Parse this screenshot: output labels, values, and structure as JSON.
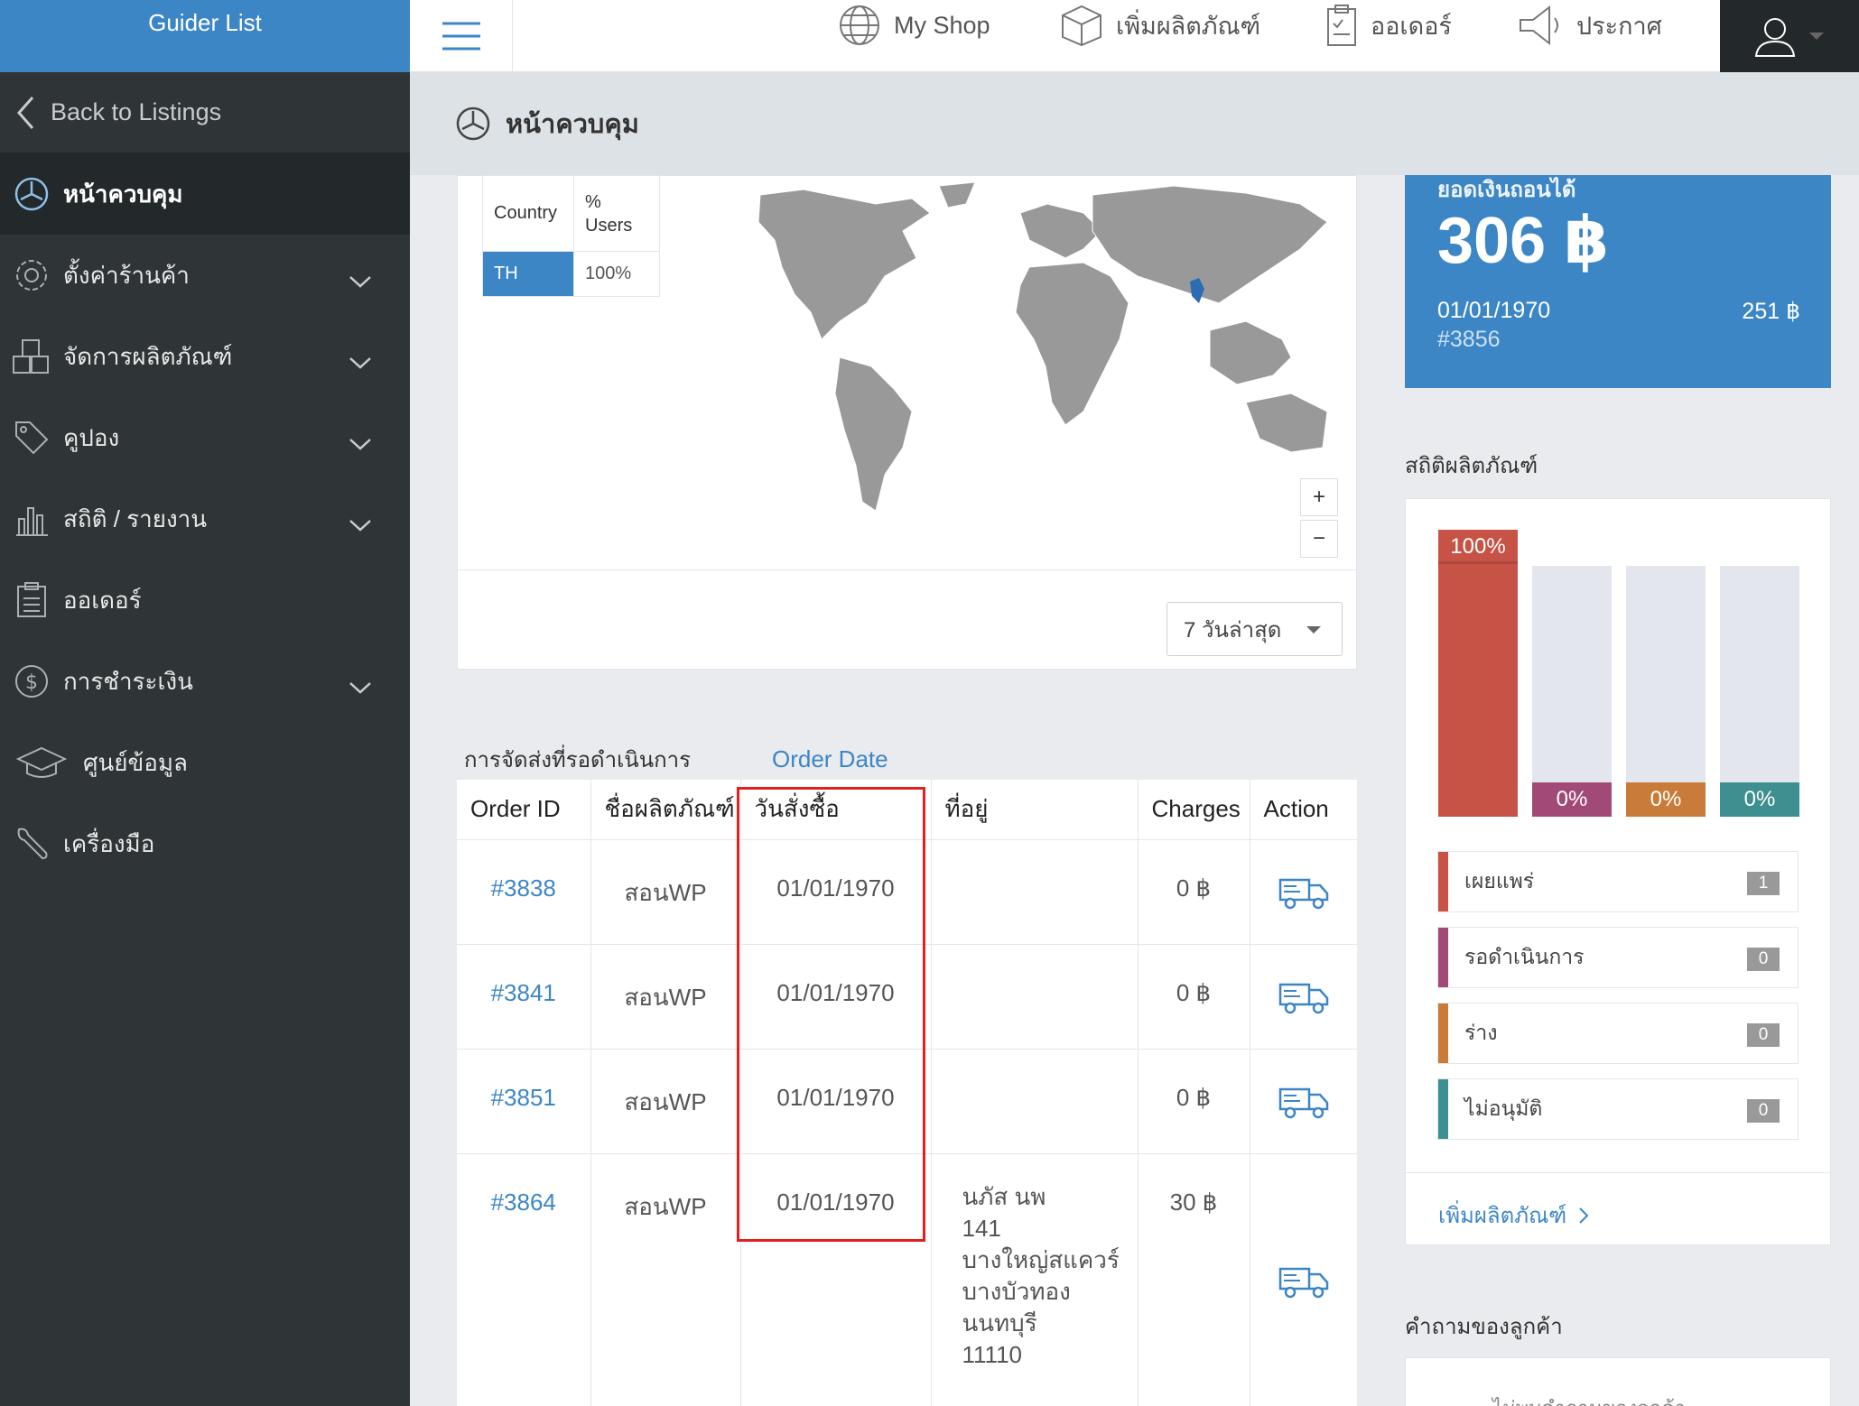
{
  "sidebar": {
    "brand": "Guider List",
    "back": "Back to Listings",
    "items": [
      {
        "label": "หน้าควบคุม",
        "icon": "dashboard-icon"
      },
      {
        "label": "ตั้งค่าร้านค้า",
        "icon": "gear-icon"
      },
      {
        "label": "จัดการผลิตภัณฑ์",
        "icon": "boxes-icon"
      },
      {
        "label": "คูปอง",
        "icon": "tag-icon"
      },
      {
        "label": "สถิติ / รายงาน",
        "icon": "bar-chart-icon"
      },
      {
        "label": "ออเดอร์",
        "icon": "clipboard-icon"
      },
      {
        "label": "การชำระเงิน",
        "icon": "dollar-icon"
      },
      {
        "label": "ศูนย์ข้อมูล",
        "icon": "graduation-cap-icon"
      },
      {
        "label": "เครื่องมือ",
        "icon": "wrench-icon"
      }
    ]
  },
  "topbar": {
    "myshop": "My Shop",
    "add_product": "เพิ่มผลิตภัณฑ์",
    "orders": "ออเดอร์",
    "announce": "ประกาศ"
  },
  "page": {
    "title": "หน้าควบคุม"
  },
  "map": {
    "col_country": "Country",
    "col_users": "% Users",
    "row_country": "TH",
    "row_users": "100%",
    "zoom_in": "+",
    "zoom_out": "−",
    "range_select": "7 วันล่าสุด"
  },
  "orders": {
    "section_title": "การจัดส่งที่รอดำเนินการ",
    "annotation": "Order Date",
    "headers": [
      "Order ID",
      "ชื่อผลิตภัณฑ์",
      "วันสั่งซื้อ",
      "ที่อยู่",
      "Charges",
      "Action"
    ],
    "rows": [
      {
        "id": "#3838",
        "product": "สอนWP",
        "date": "01/01/1970",
        "address": "",
        "charges": "0 ฿"
      },
      {
        "id": "#3841",
        "product": "สอนWP",
        "date": "01/01/1970",
        "address": "",
        "charges": "0 ฿"
      },
      {
        "id": "#3851",
        "product": "สอนWP",
        "date": "01/01/1970",
        "address": "",
        "charges": "0 ฿"
      },
      {
        "id": "#3864",
        "product": "สอนWP",
        "date": "01/01/1970",
        "address": [
          "นภัส นพ",
          "141",
          "บางใหญ่สแควร์",
          "บางบัวทอง",
          "นนทบุรี",
          "11110"
        ],
        "charges": "30 ฿"
      }
    ]
  },
  "balance": {
    "label": "ยอดเงินถอนได้",
    "amount": "306 ฿",
    "date": "01/01/1970",
    "last_amount": "251 ฿",
    "order_ref": "#3856"
  },
  "product_stats": {
    "title": "สถิติผลิตภัณฑ์",
    "bars": [
      {
        "label": "100%",
        "fraction": 1.0,
        "color": "#c65346"
      },
      {
        "label": "0%",
        "fraction": 0.0,
        "color": "#a24a77"
      },
      {
        "label": "0%",
        "fraction": 0.0,
        "color": "#c97b3a"
      },
      {
        "label": "0%",
        "fraction": 0.0,
        "color": "#3e8f8f"
      }
    ],
    "rows": [
      {
        "label": "เผยแพร่",
        "count": "1",
        "color": "#c65346"
      },
      {
        "label": "รอดำเนินการ",
        "count": "0",
        "color": "#a24a77"
      },
      {
        "label": "ร่าง",
        "count": "0",
        "color": "#c97b3a"
      },
      {
        "label": "ไม่อนุมัติ",
        "count": "0",
        "color": "#3e8f8f"
      }
    ],
    "add_link": "เพิ่มผลิตภัณฑ์"
  },
  "questions": {
    "title": "คำถามของลูกค้า",
    "empty_text": "ไม่พบคำถามของลูกค้า"
  }
}
